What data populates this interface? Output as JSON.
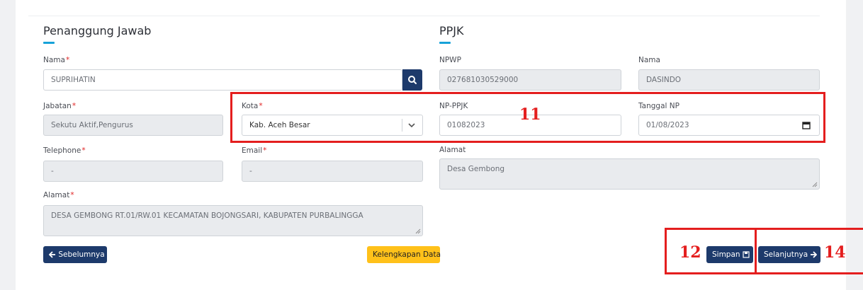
{
  "responsible": {
    "title": "Penanggung Jawab",
    "name_label": "Nama",
    "name_value": "SUPRIHATIN",
    "position_label": "Jabatan",
    "position_value": "Sekutu Aktif,Pengurus",
    "city_label": "Kota",
    "city_value": "Kab. Aceh Besar",
    "phone_label": "Telephone",
    "phone_value": "-",
    "email_label": "Email",
    "email_value": "-",
    "address_label": "Alamat",
    "address_value": "DESA GEMBONG RT.01/RW.01 KECAMATAN BOJONGSARI, KABUPATEN PURBALINGGA",
    "required_mark": "*"
  },
  "ppjk": {
    "title": "PPJK",
    "npwp_label": "NPWP",
    "npwp_value": "027681030529000",
    "name_label": "Nama",
    "name_value": "DASINDO",
    "np_label": "NP-PPJK",
    "np_value": "01082023",
    "date_label": "Tanggal NP",
    "date_value": "01/08/2023",
    "address_label": "Alamat",
    "address_value": "Desa Gembong"
  },
  "buttons": {
    "prev": "Sebelumnya",
    "completeness": "Kelengkapan Data",
    "save": "Simpan",
    "next": "Selanjutnya"
  },
  "annotations": {
    "m11": "11",
    "m12": "12",
    "m14": "14"
  },
  "colors": {
    "primary": "#1d3a6b",
    "accent": "#17a2d8",
    "warning": "#ffc11a",
    "annotation": "#e41e1e",
    "required": "#e02424"
  }
}
